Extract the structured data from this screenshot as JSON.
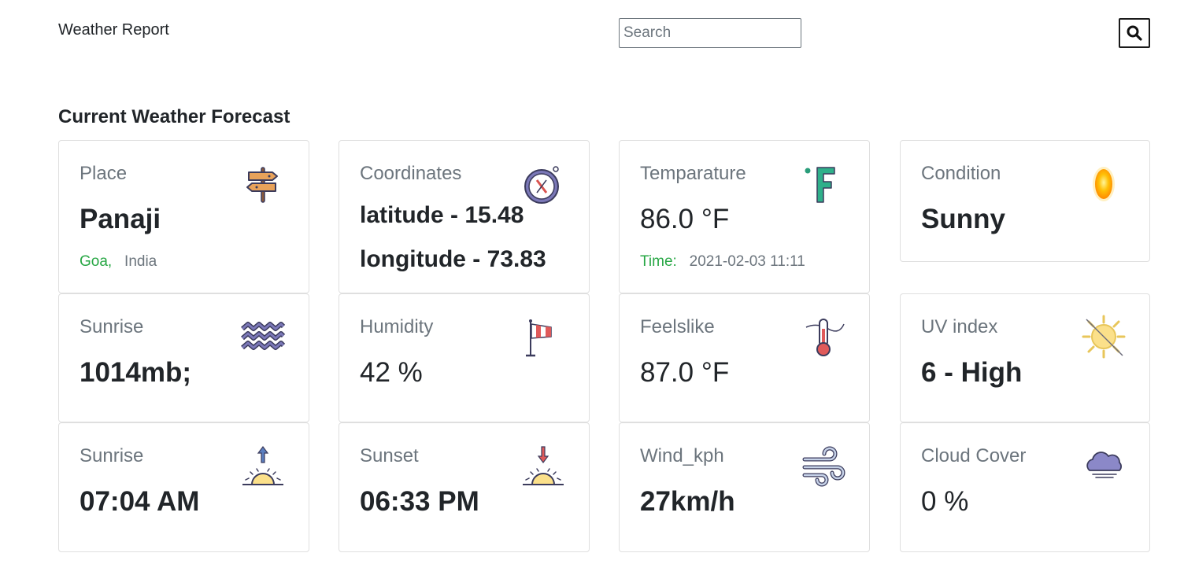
{
  "header": {
    "brand": "Weather Report",
    "search_placeholder": "Search"
  },
  "section_title": "Current Weather Forecast",
  "cards": {
    "place": {
      "label": "Place",
      "value": "Panaji",
      "region": "Goa,",
      "country": "India",
      "icon": "signpost-icon"
    },
    "coordinates": {
      "label": "Coordinates",
      "latitude": "latitude - 15.48",
      "longitude": "longitude - 73.83",
      "icon": "compass-icon"
    },
    "temperature": {
      "label": "Temparature",
      "value": "86.0",
      "unit": "°F",
      "time_label": "Time:",
      "time_value": "2021-02-03 11:11",
      "icon": "fahrenheit-icon"
    },
    "condition": {
      "label": "Condition",
      "value": "Sunny",
      "icon": "sun-orb-icon"
    },
    "pressure": {
      "label": "Sunrise",
      "value": "1014mb;",
      "icon": "waves-icon"
    },
    "humidity": {
      "label": "Humidity",
      "value": "42",
      "unit": "%",
      "icon": "windsock-icon"
    },
    "feelslike": {
      "label": "Feelslike",
      "value": "87.0",
      "unit": "°F",
      "icon": "thermometer-icon"
    },
    "uv": {
      "label": "UV index",
      "value": "6 - High",
      "icon": "sun-crossed-icon"
    },
    "sunrise": {
      "label": "Sunrise",
      "value": "07:04 AM",
      "icon": "sunrise-icon"
    },
    "sunset": {
      "label": "Sunset",
      "value": "06:33 PM",
      "icon": "sunset-icon"
    },
    "wind": {
      "label": "Wind_kph",
      "value": "27km/h",
      "icon": "wind-icon"
    },
    "cloud": {
      "label": "Cloud Cover",
      "value": "0",
      "unit": "%",
      "icon": "cloud-icon"
    }
  },
  "colors": {
    "accent_green": "#28a745",
    "muted_text": "#6c757d",
    "card_border": "#dfdfdf"
  }
}
